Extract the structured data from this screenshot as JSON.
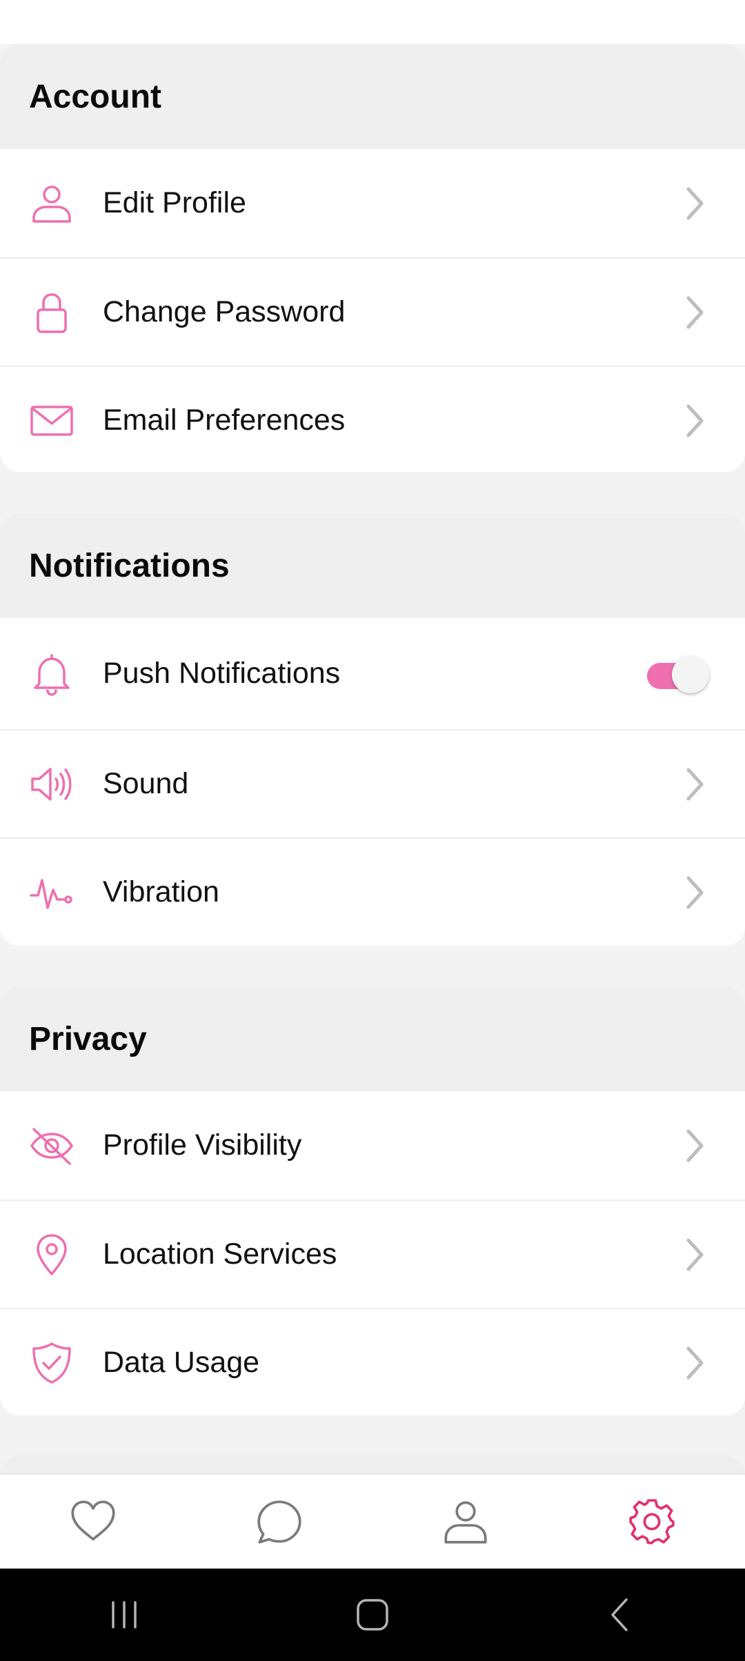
{
  "colors": {
    "accent": "#f06fb1",
    "active_nav": "#e0336e",
    "icon_pink": "#ee6fb0"
  },
  "sections": {
    "account": {
      "title": "Account",
      "items": [
        {
          "label": "Edit Profile",
          "icon": "person-icon"
        },
        {
          "label": "Change Password",
          "icon": "lock-icon"
        },
        {
          "label": "Email Preferences",
          "icon": "mail-icon"
        }
      ]
    },
    "notifications": {
      "title": "Notifications",
      "items": [
        {
          "label": "Push Notifications",
          "icon": "bell-icon",
          "toggle_on": true
        },
        {
          "label": "Sound",
          "icon": "speaker-icon"
        },
        {
          "label": "Vibration",
          "icon": "pulse-icon"
        }
      ]
    },
    "privacy": {
      "title": "Privacy",
      "items": [
        {
          "label": "Profile Visibility",
          "icon": "eye-off-icon"
        },
        {
          "label": "Location Services",
          "icon": "location-pin-icon"
        },
        {
          "label": "Data Usage",
          "icon": "shield-check-icon"
        }
      ]
    }
  },
  "bottom_nav": {
    "items": [
      {
        "icon": "heart-icon",
        "active": false
      },
      {
        "icon": "chat-bubble-icon",
        "active": false
      },
      {
        "icon": "profile-icon",
        "active": false
      },
      {
        "icon": "settings-gear-icon",
        "active": true
      }
    ]
  },
  "system_nav": {
    "items": [
      "recent-apps-icon",
      "home-icon",
      "back-icon"
    ]
  }
}
